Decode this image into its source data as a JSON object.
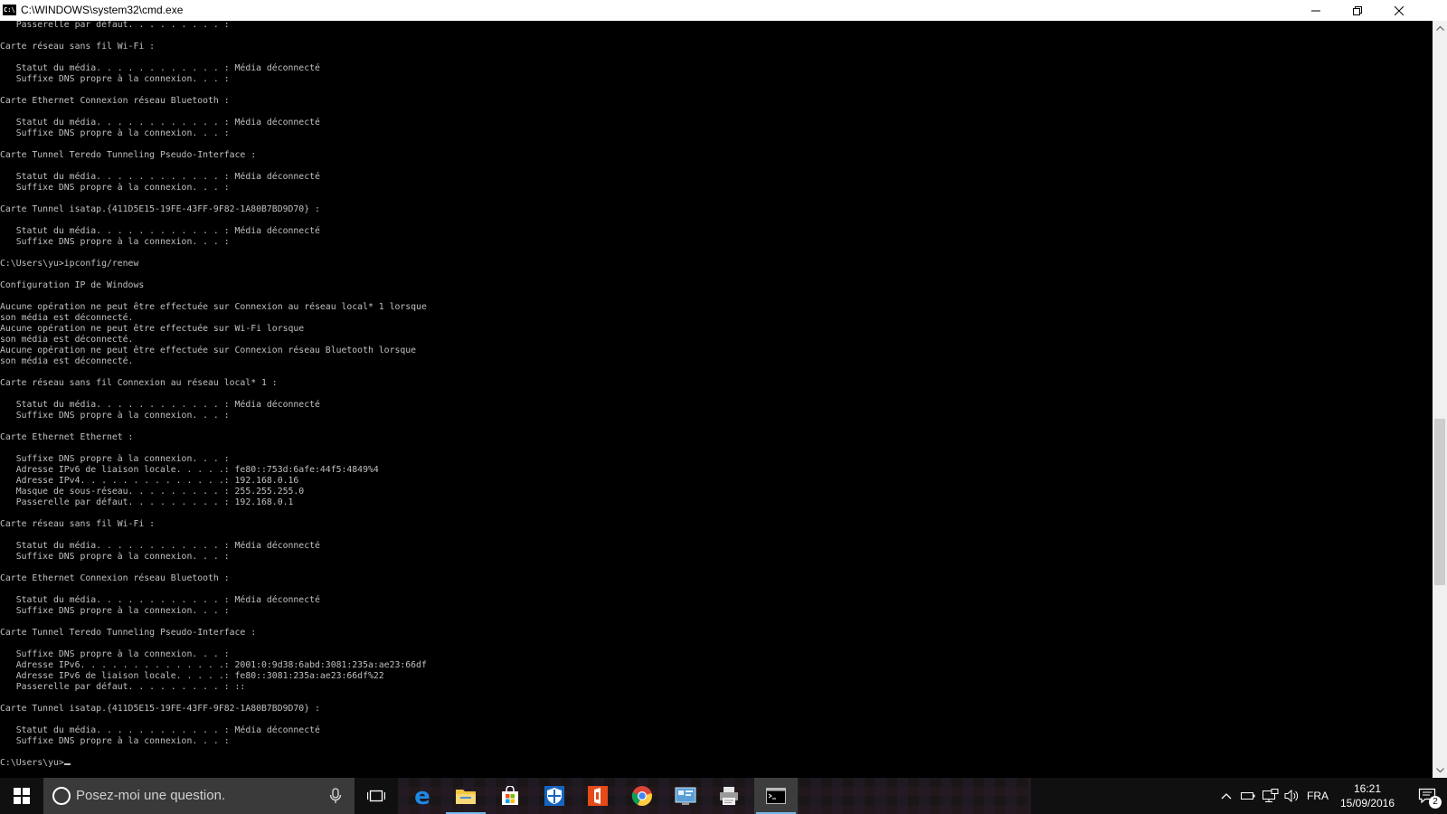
{
  "window": {
    "title": "C:\\WINDOWS\\system32\\cmd.exe",
    "icon_text": "C:\\"
  },
  "console": {
    "lines": [
      "   Passerelle par défaut. . . . . . . . . :",
      "",
      "Carte réseau sans fil Wi-Fi :",
      "",
      "   Statut du média. . . . . . . . . . . . : Média déconnecté",
      "   Suffixe DNS propre à la connexion. . . :",
      "",
      "Carte Ethernet Connexion réseau Bluetooth :",
      "",
      "   Statut du média. . . . . . . . . . . . : Média déconnecté",
      "   Suffixe DNS propre à la connexion. . . :",
      "",
      "Carte Tunnel Teredo Tunneling Pseudo-Interface :",
      "",
      "   Statut du média. . . . . . . . . . . . : Média déconnecté",
      "   Suffixe DNS propre à la connexion. . . :",
      "",
      "Carte Tunnel isatap.{411D5E15-19FE-43FF-9F82-1A80B7BD9D70} :",
      "",
      "   Statut du média. . . . . . . . . . . . : Média déconnecté",
      "   Suffixe DNS propre à la connexion. . . :",
      "",
      "C:\\Users\\yu>ipconfig/renew",
      "",
      "Configuration IP de Windows",
      "",
      "Aucune opération ne peut être effectuée sur Connexion au réseau local* 1 lorsque",
      "son média est déconnecté.",
      "Aucune opération ne peut être effectuée sur Wi-Fi lorsque",
      "son média est déconnecté.",
      "Aucune opération ne peut être effectuée sur Connexion réseau Bluetooth lorsque",
      "son média est déconnecté.",
      "",
      "Carte réseau sans fil Connexion au réseau local* 1 :",
      "",
      "   Statut du média. . . . . . . . . . . . : Média déconnecté",
      "   Suffixe DNS propre à la connexion. . . :",
      "",
      "Carte Ethernet Ethernet :",
      "",
      "   Suffixe DNS propre à la connexion. . . :",
      "   Adresse IPv6 de liaison locale. . . . .: fe80::753d:6afe:44f5:4849%4",
      "   Adresse IPv4. . . . . . . . . . . . . .: 192.168.0.16",
      "   Masque de sous-réseau. . . . . . . . . : 255.255.255.0",
      "   Passerelle par défaut. . . . . . . . . : 192.168.0.1",
      "",
      "Carte réseau sans fil Wi-Fi :",
      "",
      "   Statut du média. . . . . . . . . . . . : Média déconnecté",
      "   Suffixe DNS propre à la connexion. . . :",
      "",
      "Carte Ethernet Connexion réseau Bluetooth :",
      "",
      "   Statut du média. . . . . . . . . . . . : Média déconnecté",
      "   Suffixe DNS propre à la connexion. . . :",
      "",
      "Carte Tunnel Teredo Tunneling Pseudo-Interface :",
      "",
      "   Suffixe DNS propre à la connexion. . . :",
      "   Adresse IPv6. . . . . . . . . . . . . .: 2001:0:9d38:6abd:3081:235a:ae23:66df",
      "   Adresse IPv6 de liaison locale. . . . .: fe80::3081:235a:ae23:66df%22",
      "   Passerelle par défaut. . . . . . . . . : ::",
      "",
      "Carte Tunnel isatap.{411D5E15-19FE-43FF-9F82-1A80B7BD9D70} :",
      "",
      "   Statut du média. . . . . . . . . . . . : Média déconnecté",
      "   Suffixe DNS propre à la connexion. . . :",
      ""
    ],
    "prompt": "C:\\Users\\yu>"
  },
  "taskbar": {
    "search_placeholder": "Posez-moi une question.",
    "apps": [
      {
        "name": "task-view-icon"
      },
      {
        "name": "edge-icon",
        "color": "#1e88e5"
      },
      {
        "name": "file-explorer-icon",
        "color": "#f4c542",
        "running": true
      },
      {
        "name": "store-icon"
      },
      {
        "name": "defender-icon",
        "color": "#1565c0"
      },
      {
        "name": "office-icon",
        "color": "#e64a19"
      },
      {
        "name": "chrome-icon"
      },
      {
        "name": "control-panel-icon",
        "color": "#5aa0d8"
      },
      {
        "name": "printer-icon"
      },
      {
        "name": "cmd-icon",
        "active": true
      }
    ],
    "language": "FRA",
    "time": "16:21",
    "date": "15/09/2016",
    "notification_count": "2"
  }
}
